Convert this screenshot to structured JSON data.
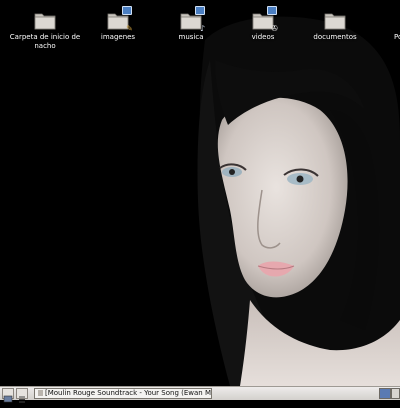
{
  "desktop": {
    "icons": [
      {
        "label": "Carpeta de inicio de nacho",
        "icon": "home-folder-icon"
      },
      {
        "label": "imagenes",
        "icon": "folder-link-icon"
      },
      {
        "label": "musica",
        "icon": "folder-link-icon"
      },
      {
        "label": "videos",
        "icon": "folder-link-icon"
      },
      {
        "label": "documentos",
        "icon": "folder-icon"
      },
      {
        "label": "Po",
        "icon": "folder-icon"
      }
    ]
  },
  "taskbar": {
    "window_title": "[Moulin Rouge Soundtrack - Your Song (Ewan McGregor)]"
  },
  "colors": {
    "desktop_bg": "#000000",
    "taskbar_bg": "#e0ddd9",
    "folder": "#c9c5be",
    "link_badge": "#4b7fc2"
  }
}
